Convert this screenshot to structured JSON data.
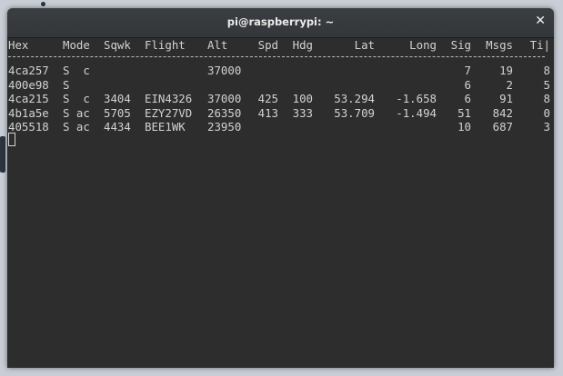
{
  "window": {
    "title": "pi@raspberrypi: ~",
    "close_icon": "close-icon"
  },
  "table": {
    "headers": [
      "Hex",
      "Mode",
      "Sqwk",
      "Flight",
      "Alt",
      "Spd",
      "Hdg",
      "Lat",
      "Long",
      "Sig",
      "Msgs",
      "Ti|"
    ],
    "rows": [
      [
        "4ca257",
        "S  c",
        "",
        "",
        "37000",
        "",
        "",
        "",
        "",
        "7",
        "19",
        "8"
      ],
      [
        "400e98",
        "S",
        "",
        "",
        "",
        "",
        "",
        "",
        "",
        "6",
        "2",
        "5"
      ],
      [
        "4ca215",
        "S  c",
        "3404",
        "EIN4326",
        "37000",
        "425",
        "100",
        "53.294",
        "-1.658",
        "6",
        "91",
        "8"
      ],
      [
        "4b1a5e",
        "S ac",
        "5705",
        "EZY27VD",
        "26350",
        "413",
        "333",
        "53.709",
        "-1.494",
        "51",
        "842",
        "0"
      ],
      [
        "405518",
        "S ac",
        "4434",
        "BEE1WK",
        "23950",
        "",
        "",
        "",
        "",
        "10",
        "687",
        "3"
      ]
    ]
  }
}
